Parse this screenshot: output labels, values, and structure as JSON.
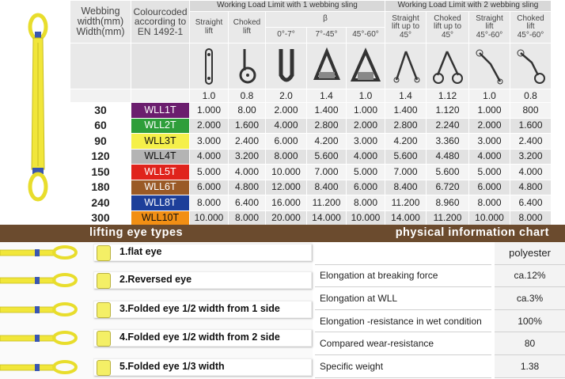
{
  "header": {
    "webbing_width_label": "Webbing\nwidth(mm)\nWidth(mm)",
    "colourcoded_label": "Colourcoded\naccording to\nEN 1492-1",
    "wll1_group": "Working Load Limit with 1 webbing sling",
    "wll2_group": "Working Load Limit with 2 webbing sling",
    "straight_lift": "Straight\nlift",
    "choked_lift": "Choked\nlift",
    "beta": "β",
    "angle_0_7": "0°-7°",
    "angle_7_45": "7°-45°",
    "angle_45_60": "45°-60°",
    "straight_up_45": "Straight\nlift up to\n45°",
    "choked_up_45": "Choked\nlift up to\n45°",
    "straight_45_60": "Straight\nlift\n45°-60°",
    "choked_45_60": "Choked\nlift\n45°-60°"
  },
  "factors": [
    "1.0",
    "0.8",
    "2.0",
    "1.4",
    "1.0",
    "1.4",
    "1.12",
    "1.0",
    "0.8"
  ],
  "rows": [
    {
      "width": "30",
      "code": "WLL1T",
      "color": "#6b1d6e",
      "text_color": "#ffffff",
      "values": [
        "1.000",
        "8.00",
        "2.000",
        "1.400",
        "1.000",
        "1.400",
        "1.120",
        "1.000",
        "800"
      ]
    },
    {
      "width": "60",
      "code": "WLL2T",
      "color": "#2e9e3a",
      "text_color": "#ffffff",
      "values": [
        "2.000",
        "1.600",
        "4.000",
        "2.800",
        "2.000",
        "2.800",
        "2.240",
        "2.000",
        "1.600"
      ]
    },
    {
      "width": "90",
      "code": "WLL3T",
      "color": "#f5f04a",
      "text_color": "#111111",
      "values": [
        "3.000",
        "2.400",
        "6.000",
        "4.200",
        "3.000",
        "4.200",
        "3.360",
        "3.000",
        "2.400"
      ]
    },
    {
      "width": "120",
      "code": "WLL4T",
      "color": "#b4b4b4",
      "text_color": "#111111",
      "values": [
        "4.000",
        "3.200",
        "8.000",
        "5.600",
        "4.000",
        "5.600",
        "4.480",
        "4.000",
        "3.200"
      ]
    },
    {
      "width": "150",
      "code": "WLL5T",
      "color": "#e0231c",
      "text_color": "#ffffff",
      "values": [
        "5.000",
        "4.000",
        "10.000",
        "7.000",
        "5.000",
        "7.000",
        "5.600",
        "5.000",
        "4.000"
      ]
    },
    {
      "width": "180",
      "code": "WLL6T",
      "color": "#9a5a26",
      "text_color": "#ffffff",
      "values": [
        "6.000",
        "4.800",
        "12.000",
        "8.400",
        "6.000",
        "8.400",
        "6.720",
        "6.000",
        "4.800"
      ]
    },
    {
      "width": "240",
      "code": "WLL8T",
      "color": "#1d3f9a",
      "text_color": "#ffffff",
      "values": [
        "8.000",
        "6.400",
        "16.000",
        "11.200",
        "8.000",
        "11.200",
        "8.960",
        "8.000",
        "6.400"
      ]
    },
    {
      "width": "300",
      "code": "WLL10T",
      "color": "#f28f14",
      "text_color": "#111111",
      "values": [
        "10.000",
        "8.000",
        "20.000",
        "14.000",
        "10.000",
        "14.000",
        "11.200",
        "10.000",
        "8.000"
      ]
    }
  ],
  "lifting_eye": {
    "title": "lifting eye types",
    "items": [
      {
        "label": "1.flat eye",
        "icon": "flat-eye-icon"
      },
      {
        "label": "2.Reversed eye",
        "icon": "reversed-eye-icon"
      },
      {
        "label": "3.Folded eye 1/2 width from 1 side",
        "icon": "folded-eye-one-side-icon"
      },
      {
        "label": "4.Folded eye 1/2 width from 2 side",
        "icon": "folded-eye-two-side-icon"
      },
      {
        "label": "5.Folded eye 1/3 width",
        "icon": "folded-eye-third-icon"
      }
    ]
  },
  "physical": {
    "title": "physical information chart",
    "material": "polyester",
    "rows": [
      {
        "label": "Elongation at breaking force",
        "value": "ca.12%"
      },
      {
        "label": "Elongation at WLL",
        "value": "ca.3%"
      },
      {
        "label": "Elongation -resistance in wet condition",
        "value": "100%"
      },
      {
        "label": "Compared wear-resistance",
        "value": "80"
      },
      {
        "label": "Specific weight",
        "value": "1.38"
      }
    ]
  },
  "colors": {
    "banner": "#6b4b2e",
    "sling_yellow": "#f2ea3a",
    "header_grey": "#e9e9e9",
    "colour_header": "#6b4b2e"
  }
}
